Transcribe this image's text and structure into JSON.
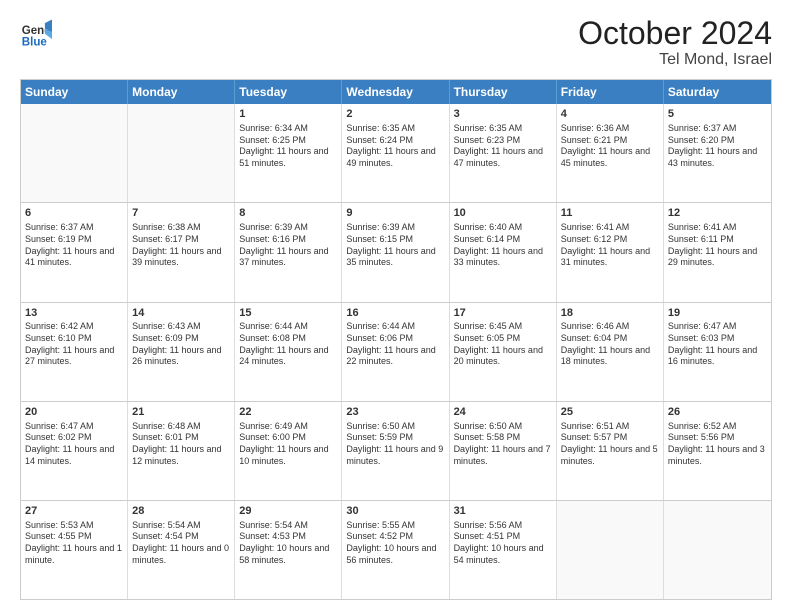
{
  "header": {
    "logo_general": "General",
    "logo_blue": "Blue",
    "month_title": "October 2024",
    "location": "Tel Mond, Israel"
  },
  "days_of_week": [
    "Sunday",
    "Monday",
    "Tuesday",
    "Wednesday",
    "Thursday",
    "Friday",
    "Saturday"
  ],
  "weeks": [
    [
      {
        "day": "",
        "info": "",
        "empty": true
      },
      {
        "day": "",
        "info": "",
        "empty": true
      },
      {
        "day": "1",
        "info": "Sunrise: 6:34 AM\nSunset: 6:25 PM\nDaylight: 11 hours and 51 minutes."
      },
      {
        "day": "2",
        "info": "Sunrise: 6:35 AM\nSunset: 6:24 PM\nDaylight: 11 hours and 49 minutes."
      },
      {
        "day": "3",
        "info": "Sunrise: 6:35 AM\nSunset: 6:23 PM\nDaylight: 11 hours and 47 minutes."
      },
      {
        "day": "4",
        "info": "Sunrise: 6:36 AM\nSunset: 6:21 PM\nDaylight: 11 hours and 45 minutes."
      },
      {
        "day": "5",
        "info": "Sunrise: 6:37 AM\nSunset: 6:20 PM\nDaylight: 11 hours and 43 minutes."
      }
    ],
    [
      {
        "day": "6",
        "info": "Sunrise: 6:37 AM\nSunset: 6:19 PM\nDaylight: 11 hours and 41 minutes."
      },
      {
        "day": "7",
        "info": "Sunrise: 6:38 AM\nSunset: 6:17 PM\nDaylight: 11 hours and 39 minutes."
      },
      {
        "day": "8",
        "info": "Sunrise: 6:39 AM\nSunset: 6:16 PM\nDaylight: 11 hours and 37 minutes."
      },
      {
        "day": "9",
        "info": "Sunrise: 6:39 AM\nSunset: 6:15 PM\nDaylight: 11 hours and 35 minutes."
      },
      {
        "day": "10",
        "info": "Sunrise: 6:40 AM\nSunset: 6:14 PM\nDaylight: 11 hours and 33 minutes."
      },
      {
        "day": "11",
        "info": "Sunrise: 6:41 AM\nSunset: 6:12 PM\nDaylight: 11 hours and 31 minutes."
      },
      {
        "day": "12",
        "info": "Sunrise: 6:41 AM\nSunset: 6:11 PM\nDaylight: 11 hours and 29 minutes."
      }
    ],
    [
      {
        "day": "13",
        "info": "Sunrise: 6:42 AM\nSunset: 6:10 PM\nDaylight: 11 hours and 27 minutes."
      },
      {
        "day": "14",
        "info": "Sunrise: 6:43 AM\nSunset: 6:09 PM\nDaylight: 11 hours and 26 minutes."
      },
      {
        "day": "15",
        "info": "Sunrise: 6:44 AM\nSunset: 6:08 PM\nDaylight: 11 hours and 24 minutes."
      },
      {
        "day": "16",
        "info": "Sunrise: 6:44 AM\nSunset: 6:06 PM\nDaylight: 11 hours and 22 minutes."
      },
      {
        "day": "17",
        "info": "Sunrise: 6:45 AM\nSunset: 6:05 PM\nDaylight: 11 hours and 20 minutes."
      },
      {
        "day": "18",
        "info": "Sunrise: 6:46 AM\nSunset: 6:04 PM\nDaylight: 11 hours and 18 minutes."
      },
      {
        "day": "19",
        "info": "Sunrise: 6:47 AM\nSunset: 6:03 PM\nDaylight: 11 hours and 16 minutes."
      }
    ],
    [
      {
        "day": "20",
        "info": "Sunrise: 6:47 AM\nSunset: 6:02 PM\nDaylight: 11 hours and 14 minutes."
      },
      {
        "day": "21",
        "info": "Sunrise: 6:48 AM\nSunset: 6:01 PM\nDaylight: 11 hours and 12 minutes."
      },
      {
        "day": "22",
        "info": "Sunrise: 6:49 AM\nSunset: 6:00 PM\nDaylight: 11 hours and 10 minutes."
      },
      {
        "day": "23",
        "info": "Sunrise: 6:50 AM\nSunset: 5:59 PM\nDaylight: 11 hours and 9 minutes."
      },
      {
        "day": "24",
        "info": "Sunrise: 6:50 AM\nSunset: 5:58 PM\nDaylight: 11 hours and 7 minutes."
      },
      {
        "day": "25",
        "info": "Sunrise: 6:51 AM\nSunset: 5:57 PM\nDaylight: 11 hours and 5 minutes."
      },
      {
        "day": "26",
        "info": "Sunrise: 6:52 AM\nSunset: 5:56 PM\nDaylight: 11 hours and 3 minutes."
      }
    ],
    [
      {
        "day": "27",
        "info": "Sunrise: 5:53 AM\nSunset: 4:55 PM\nDaylight: 11 hours and 1 minute."
      },
      {
        "day": "28",
        "info": "Sunrise: 5:54 AM\nSunset: 4:54 PM\nDaylight: 11 hours and 0 minutes."
      },
      {
        "day": "29",
        "info": "Sunrise: 5:54 AM\nSunset: 4:53 PM\nDaylight: 10 hours and 58 minutes."
      },
      {
        "day": "30",
        "info": "Sunrise: 5:55 AM\nSunset: 4:52 PM\nDaylight: 10 hours and 56 minutes."
      },
      {
        "day": "31",
        "info": "Sunrise: 5:56 AM\nSunset: 4:51 PM\nDaylight: 10 hours and 54 minutes."
      },
      {
        "day": "",
        "info": "",
        "empty": true
      },
      {
        "day": "",
        "info": "",
        "empty": true
      }
    ]
  ]
}
